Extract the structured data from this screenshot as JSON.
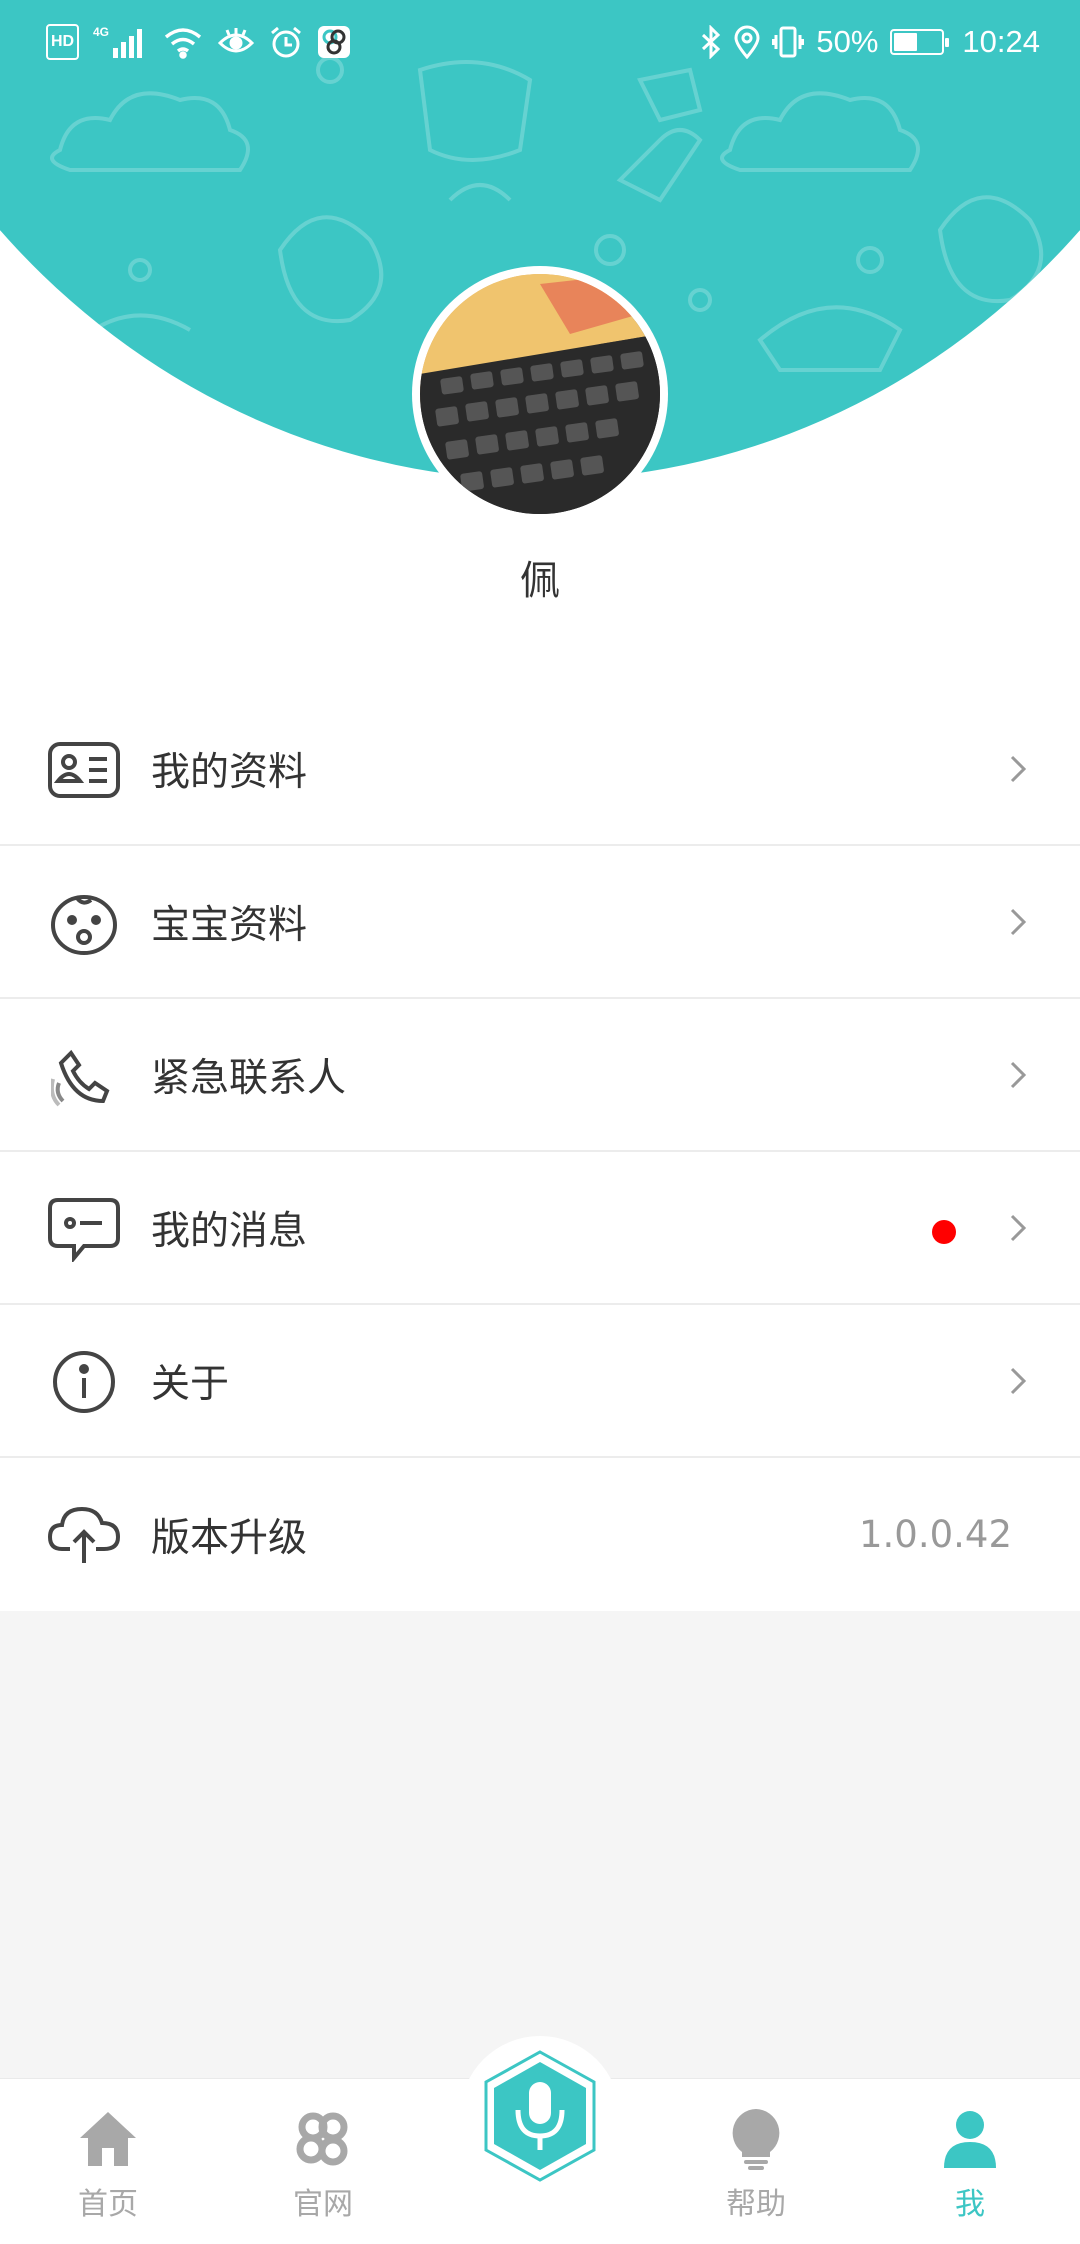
{
  "status_bar": {
    "hd": "HD",
    "network": "4G",
    "battery_percent": "50%",
    "battery_level": 0.5,
    "time": "10:24"
  },
  "profile": {
    "name": "佩"
  },
  "menu": {
    "items": [
      {
        "label": "我的资料",
        "icon": "id-card-icon"
      },
      {
        "label": "宝宝资料",
        "icon": "baby-face-icon"
      },
      {
        "label": "紧急联系人",
        "icon": "phone-ringing-icon"
      },
      {
        "label": "我的消息",
        "icon": "message-icon",
        "unread": true
      },
      {
        "label": "关于",
        "icon": "info-icon"
      },
      {
        "label": "版本升级",
        "icon": "cloud-upload-icon",
        "value": "1.0.0.42"
      }
    ]
  },
  "tabs": [
    {
      "label": "首页",
      "icon": "home-icon"
    },
    {
      "label": "官网",
      "icon": "flower-icon"
    },
    {
      "label": "",
      "icon": "microphone-icon"
    },
    {
      "label": "帮助",
      "icon": "lightbulb-icon"
    },
    {
      "label": "我",
      "icon": "person-icon",
      "active": true
    }
  ],
  "colors": {
    "accent": "#3cc6c4",
    "unread_dot": "#ff0000",
    "inactive_tab": "#a8a8a8"
  }
}
